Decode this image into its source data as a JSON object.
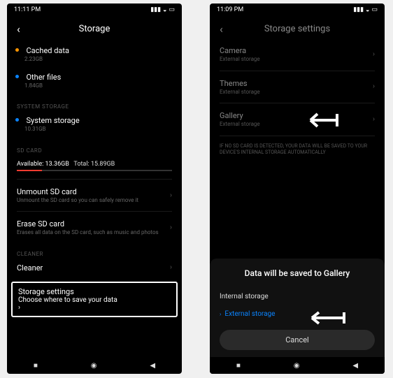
{
  "left": {
    "status_time": "11:11 PM",
    "title": "Storage",
    "cached": {
      "label": "Cached data",
      "size": "2.23GB"
    },
    "other": {
      "label": "Other files",
      "size": "1.84GB"
    },
    "sys_section": "SYSTEM STORAGE",
    "system": {
      "label": "System storage",
      "size": "10.31GB"
    },
    "sd_section": "SD CARD",
    "sd_stats": {
      "available_label": "Available:",
      "available": "13.36GB",
      "total_label": "Total:",
      "total": "15.89GB"
    },
    "unmount": {
      "label": "Unmount SD card",
      "sub": "Unmount the SD card so you can safely remove it"
    },
    "erase": {
      "label": "Erase SD card",
      "sub": "Erases all data on the SD card, such as music and photos"
    },
    "cleaner_section": "CLEANER",
    "cleaner_label": "Cleaner",
    "settings": {
      "label": "Storage settings",
      "sub": "Choose where to save your data"
    }
  },
  "right": {
    "status_time": "11:09 PM",
    "title": "Storage settings",
    "items": [
      {
        "label": "Camera",
        "sub": "External storage"
      },
      {
        "label": "Themes",
        "sub": "External storage"
      },
      {
        "label": "Gallery",
        "sub": "External storage"
      }
    ],
    "note": "IF NO SD CARD IS DETECTED, YOUR DATA WILL BE SAVED TO YOUR DEVICE'S INTERNAL STORAGE AUTOMATICALLY",
    "modal": {
      "title": "Data will be saved to Gallery",
      "options": [
        {
          "label": "Internal storage",
          "selected": false
        },
        {
          "label": "External storage",
          "selected": true
        }
      ],
      "cancel": "Cancel"
    }
  }
}
